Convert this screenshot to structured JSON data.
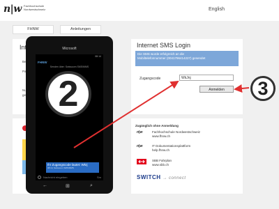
{
  "header": {
    "logo_mark": "n|w",
    "logo_lines": [
      "Fachhochschule",
      "Nordwestschweiz"
    ],
    "language": "English"
  },
  "tabs": [
    "FHNW",
    "Anleitungen"
  ],
  "left_panel": {
    "title": "Internet",
    "field_labels": [
      "Bene",
      "Pass"
    ],
    "note_lines": [
      "Nutz",
      "geles"
    ]
  },
  "login": {
    "title": "Internet SMS Login",
    "info_lines": [
      "Die SMS wurde erfolgreich an die",
      "Mobiltelefonnummer (0041796414227) gesendet"
    ],
    "code_label": "Zugangscode",
    "code_value": "WkJnj",
    "submit_label": "Anmelden"
  },
  "links": {
    "title": "Zugänglich ohne Anmeldung",
    "items": [
      {
        "icon": "n|w",
        "name": "Fachhochschule Nordwestschweiz",
        "url": "www.fhnw.ch"
      },
      {
        "icon": "n|w",
        "name": "IT Dokumentationsplattform",
        "url": "help.fhnw.ch"
      },
      {
        "icon": "sbb-icon",
        "name": "SBB Fahrplan",
        "url": "www.sbb.ch"
      }
    ],
    "switch_label": "SWITCH",
    "switch_tag": "connect"
  },
  "phone": {
    "brand": "Microsoft",
    "status_time": "08:14",
    "app_name": "FHNW",
    "sender_line": "Senden über: Swisscom SMS/MMS",
    "step": "2",
    "message": "Ihr Zugangscode lautet: Wkrj",
    "message_sub": "08:14, Swisscom SMS/MMS",
    "compose_placeholder": "Nachricht eingeben",
    "compose_extra": "Sm"
  },
  "step3": "3",
  "colors": {
    "accent": "#7da7d9",
    "arrow": "#e03030",
    "bubble": "#2a6cc4"
  }
}
